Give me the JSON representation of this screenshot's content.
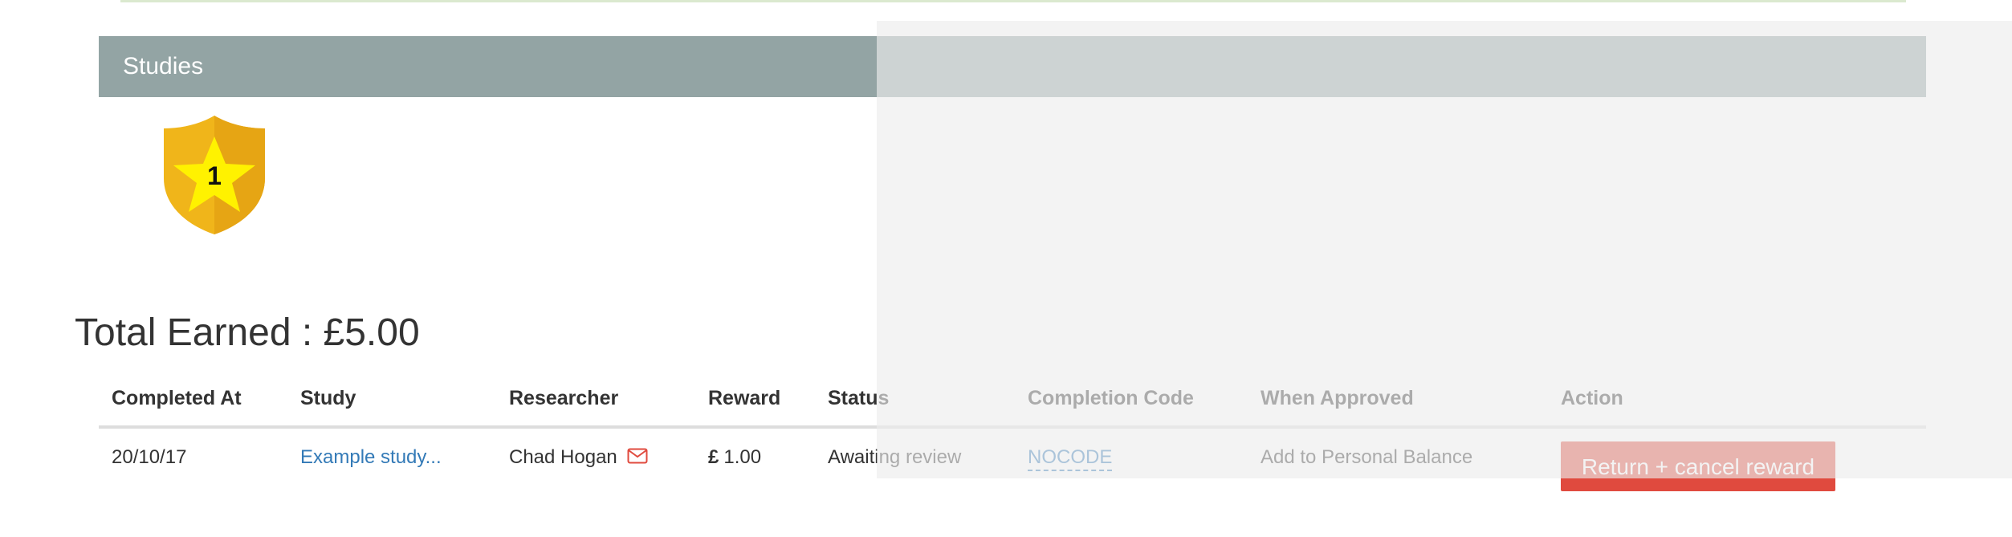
{
  "panel": {
    "title": "Studies"
  },
  "badge": {
    "count": "1"
  },
  "summary": {
    "total_earned": "Total Earned : £5.00"
  },
  "table": {
    "headers": [
      "Completed At",
      "Study",
      "Researcher",
      "Reward",
      "Status",
      "Completion Code",
      "When Approved",
      "Action"
    ],
    "rows": [
      {
        "completed_at": "20/10/17",
        "study": "Example study...",
        "researcher": "Chad Hogan",
        "reward_currency": "£",
        "reward_value": "1.00",
        "status": "Awaiting review",
        "completion_code": "NOCODE",
        "when_approved": "Add to Personal Balance",
        "action_label": "Return + cancel reward"
      }
    ]
  },
  "colors": {
    "panel_heading": "#93a4a4",
    "link": "#337ab7",
    "danger_button": "#e04a3e",
    "badge_gold": "#f0b51a",
    "badge_star": "#fff200"
  },
  "icons": {
    "researcher_contact": "envelope-icon",
    "badge": "shield-star-icon"
  }
}
